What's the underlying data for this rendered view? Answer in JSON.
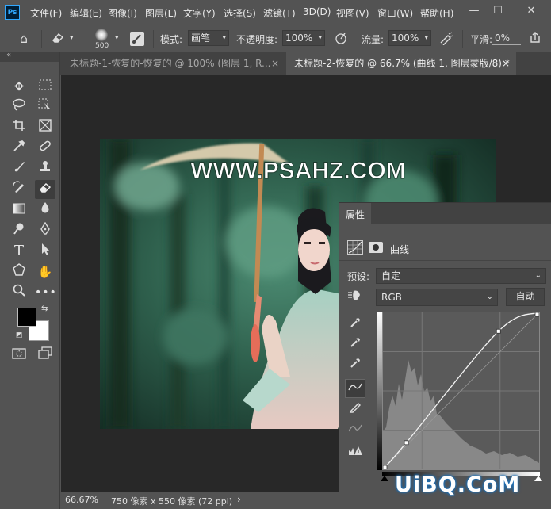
{
  "app": {
    "logo": "Ps"
  },
  "menu": [
    "文件(F)",
    "编辑(E)",
    "图像(I)",
    "图层(L)",
    "文字(Y)",
    "选择(S)",
    "滤镜(T)",
    "3D(D)",
    "视图(V)",
    "窗口(W)",
    "帮助(H)"
  ],
  "window_controls": {
    "minimize": "—",
    "maximize": "☐",
    "close": "✕"
  },
  "options": {
    "brush_size": "500",
    "mode_label": "模式:",
    "mode_value": "画笔",
    "opacity_label": "不透明度:",
    "opacity_value": "100%",
    "flow_label": "流量:",
    "flow_value": "100%",
    "smooth_label": "平滑:",
    "smooth_value": "0%"
  },
  "tabs": [
    {
      "label": "未标题-1-恢复的-恢复的 @ 100% (图层 1, R...",
      "close": "×",
      "active": false
    },
    {
      "label": "未标题-2-恢复的 @ 66.7% (曲线 1, 图层蒙版/8) *",
      "close": "×",
      "active": true
    }
  ],
  "canvas": {
    "watermark_text": "WWW.PSAHZ.COM"
  },
  "status": {
    "zoom": "66.67%",
    "doc_info": "750 像素 x 550 像素 (72 ppi)",
    "arrow": "›"
  },
  "properties": {
    "tab_title": "属性",
    "adjustment_label": "曲线",
    "preset_label": "预设:",
    "preset_value": "自定",
    "channel_value": "RGB",
    "auto_button": "自动"
  },
  "curves": {
    "points": [
      [
        0,
        0
      ],
      [
        0.15,
        0.17
      ],
      [
        0.74,
        0.88
      ],
      [
        1,
        1
      ]
    ]
  },
  "site_watermark": "UiBQ.CoM",
  "colors": {
    "accent": "#31a8ff",
    "foreground": "#000000",
    "background": "#ffffff"
  }
}
